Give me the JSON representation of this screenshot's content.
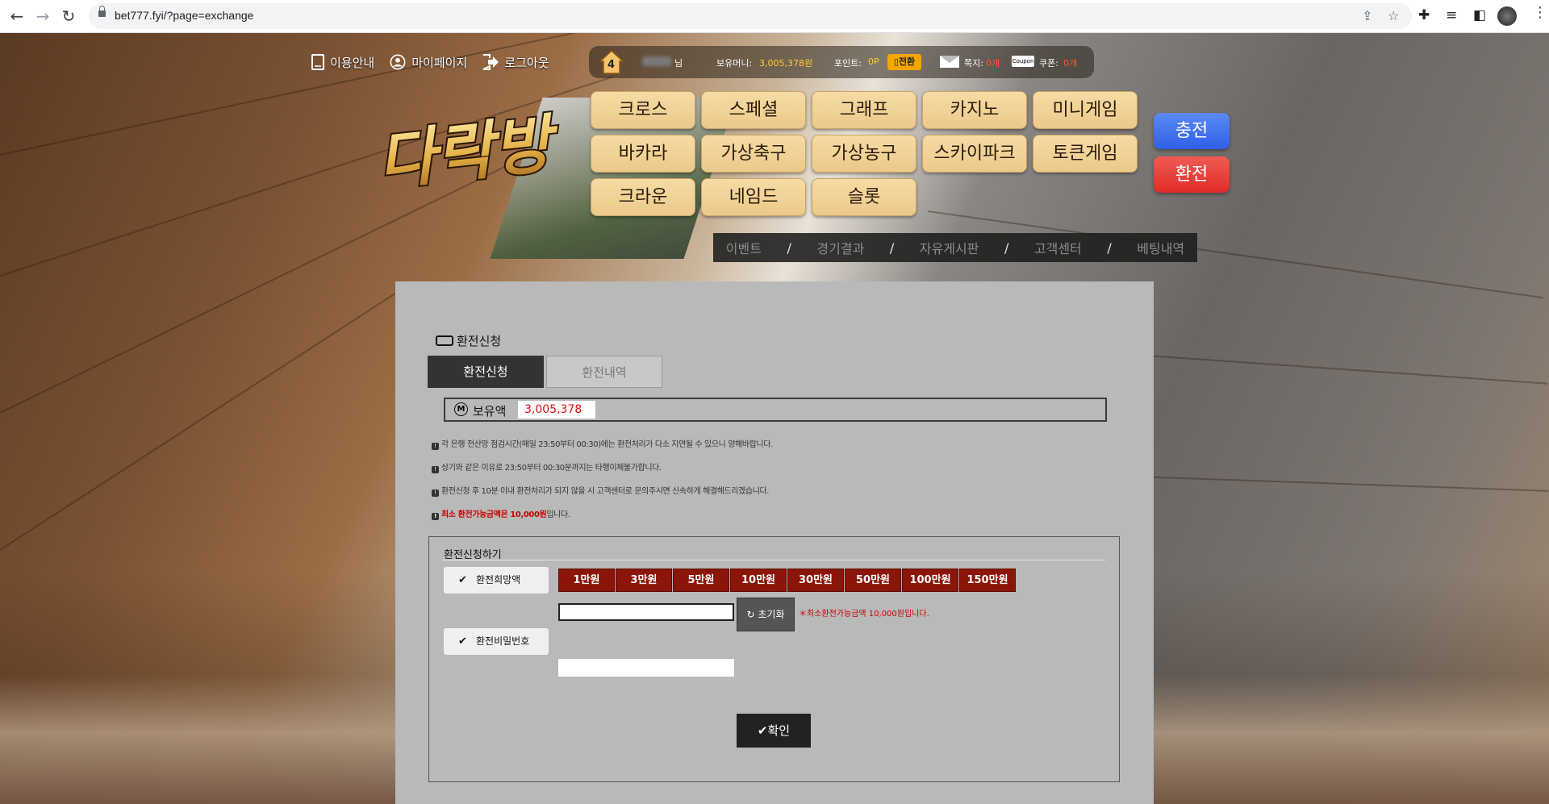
{
  "browser": {
    "url": "bet777.fyi/?page=exchange"
  },
  "top_links": [
    {
      "label": "이용안내",
      "icon": "guide-book-icon"
    },
    {
      "label": "마이페이지",
      "icon": "user-icon"
    },
    {
      "label": "로그아웃",
      "icon": "logout-icon"
    }
  ],
  "info_bar": {
    "level": "4",
    "name_suffix": "님",
    "money_label": "보유머니:",
    "money_value": "3,005,378원",
    "point_label": "포인트:",
    "point_value": "0P",
    "swap_label": "전환",
    "message_label": "쪽지:",
    "message_count": "0개",
    "coupon_tag": "Coupon",
    "coupon_label": "쿠폰:",
    "coupon_count": "0개"
  },
  "logo_text": "다락방",
  "games_row1": [
    "크로스",
    "스페셜",
    "그래프",
    "카지노",
    "미니게임"
  ],
  "games_row2": [
    "바카라",
    "가상축구",
    "가상농구",
    "스카이파크",
    "토큰게임"
  ],
  "games_row3": [
    "크라운",
    "네임드",
    "슬롯"
  ],
  "side_buttons": {
    "charge": "충전",
    "exchange": "환전"
  },
  "sub_nav": [
    "이벤트",
    "경기결과",
    "자유게시판",
    "고객센터",
    "베팅내역"
  ],
  "sub_nav_sep": "/",
  "section": {
    "title": "환전신청",
    "tabs": [
      "환전신청",
      "환전내역"
    ],
    "balance_icon_letter": "M",
    "balance_label": "보유액",
    "balance_value": "3,005,378",
    "notices": [
      "각 은행 전산망 점검시간(매일 23:50부터 00:30)에는 환전처리가 다소 지연될 수 있으니 양해바랍니다.",
      "상기와 같은 이유로 23:50부터 00:30분까지는 타행이체불가합니다.",
      "환전신청 후 10분 이내 환전처리가 되지 않을 시 고객센터로 문의주시면 신속하게 해결해드리겠습니다."
    ],
    "min_notice_bold": "최소 환전가능금액은 10,000원",
    "min_notice_suffix": "입니다.",
    "form_title": "환전신청하기",
    "amount_label": "환전희망액",
    "amount_buttons": [
      "1만원",
      "3만원",
      "5만원",
      "10만원",
      "30만원",
      "50만원",
      "100만원",
      "150만원"
    ],
    "reset_label": "초기화",
    "min_note": "＊최소환전가능금액 10,000원입니다.",
    "password_label": "환전비밀번호",
    "confirm_label": "확인",
    "check_mark": "✔"
  },
  "colors": {
    "game_button": "#ecc98b",
    "charge": "#2f5fe6",
    "exchange": "#e02c28",
    "amount_button": "#8b1508",
    "panel": "#b9b9b9"
  }
}
